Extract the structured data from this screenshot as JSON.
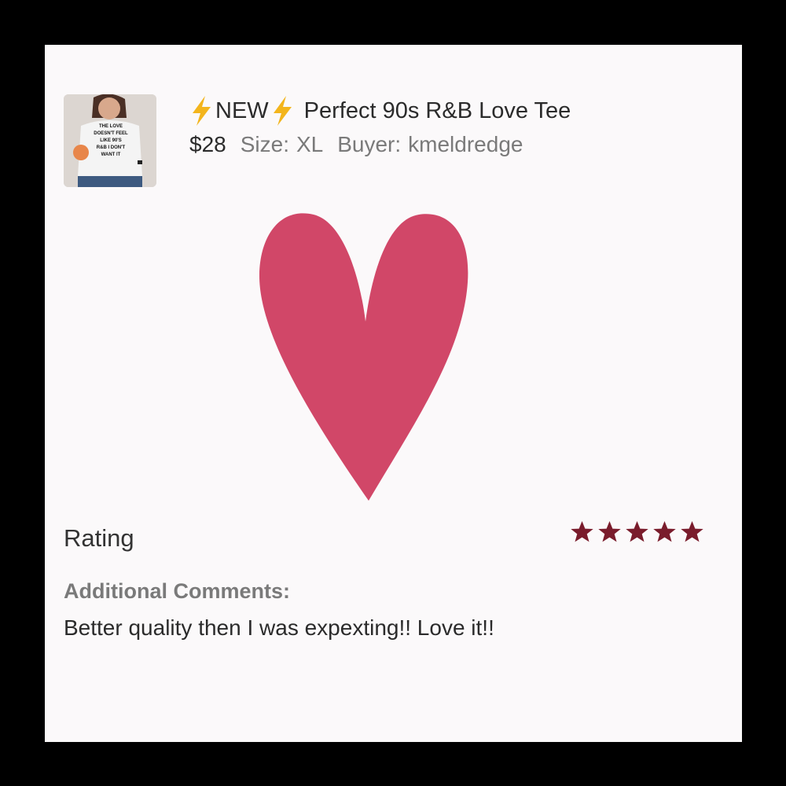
{
  "listing": {
    "title_prefix": "NEW",
    "title": "Perfect 90s R&B Love Tee",
    "price": "$28",
    "size_label": "Size:",
    "size_value": "XL",
    "buyer_label": "Buyer:",
    "buyer_value": "kmeldredge",
    "thumbnail_shirt_text": [
      "THE LOVE",
      "DOESN'T FEEL",
      "LIKE 90'S",
      "R&B I DON'T",
      "WANT IT"
    ]
  },
  "review": {
    "rating_label": "Rating",
    "rating_value": 5,
    "rating_max": 5,
    "comments_heading": "Additional Comments:",
    "comments_text": "Better quality then I was expexting!! Love it!!"
  },
  "colors": {
    "heart": "#d14768",
    "star": "#7a1c2c",
    "bolt": "#f3b51c",
    "frame": "#000000",
    "card": "#fbf9fa"
  },
  "icons": {
    "bolt": "lightning-bolt-icon",
    "star": "star-icon",
    "heart": "heart-icon"
  }
}
